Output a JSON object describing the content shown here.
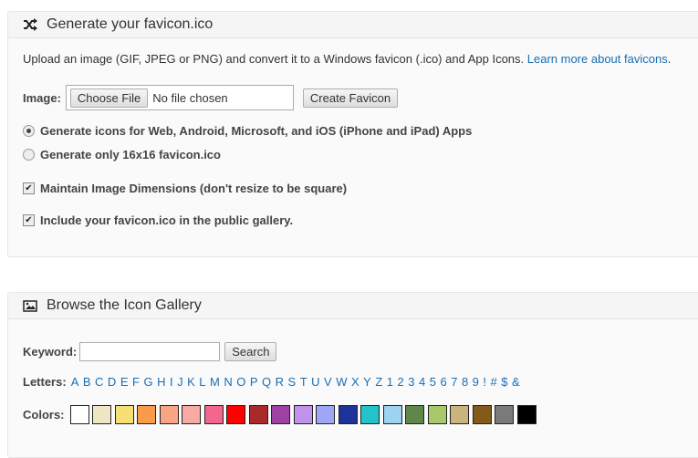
{
  "generate": {
    "title": "Generate your favicon.ico",
    "intro": "Upload an image (GIF, JPEG or PNG) and convert it to a Windows favicon (.ico) and App Icons.",
    "learn_more": "Learn more about favicons",
    "learn_more_suffix": ".",
    "image_label": "Image:",
    "choose_file": "Choose File",
    "file_status": "No file chosen",
    "create_button": "Create Favicon",
    "radio_all": "Generate icons for Web, Android, Microsoft, and iOS (iPhone and iPad) Apps",
    "radio_16": "Generate only 16x16 favicon.ico",
    "check_dims": "Maintain Image Dimensions (don't resize to be square)",
    "check_gallery": "Include your favicon.ico in the public gallery."
  },
  "gallery": {
    "title": "Browse the Icon Gallery",
    "keyword_label": "Keyword:",
    "keyword_value": "",
    "search_button": "Search",
    "letters_label": "Letters:",
    "letters": [
      "A",
      "B",
      "C",
      "D",
      "E",
      "F",
      "G",
      "H",
      "I",
      "J",
      "K",
      "L",
      "M",
      "N",
      "O",
      "P",
      "Q",
      "R",
      "S",
      "T",
      "U",
      "V",
      "W",
      "X",
      "Y",
      "Z",
      "1",
      "2",
      "3",
      "4",
      "5",
      "6",
      "7",
      "8",
      "9",
      "!",
      "#",
      "$",
      "&"
    ],
    "colors_label": "Colors:",
    "colors": [
      "#ffffff",
      "#f1e6c4",
      "#f6df74",
      "#f99b4a",
      "#f7a585",
      "#f8aaa5",
      "#f3678f",
      "#ff0000",
      "#a82a2a",
      "#9d41a4",
      "#c092ea",
      "#a0a6f7",
      "#1e3399",
      "#23c4c9",
      "#9dd2f0",
      "#5f874b",
      "#a8c96a",
      "#c8b47c",
      "#835a19",
      "#7a7a7a",
      "#000000"
    ]
  }
}
